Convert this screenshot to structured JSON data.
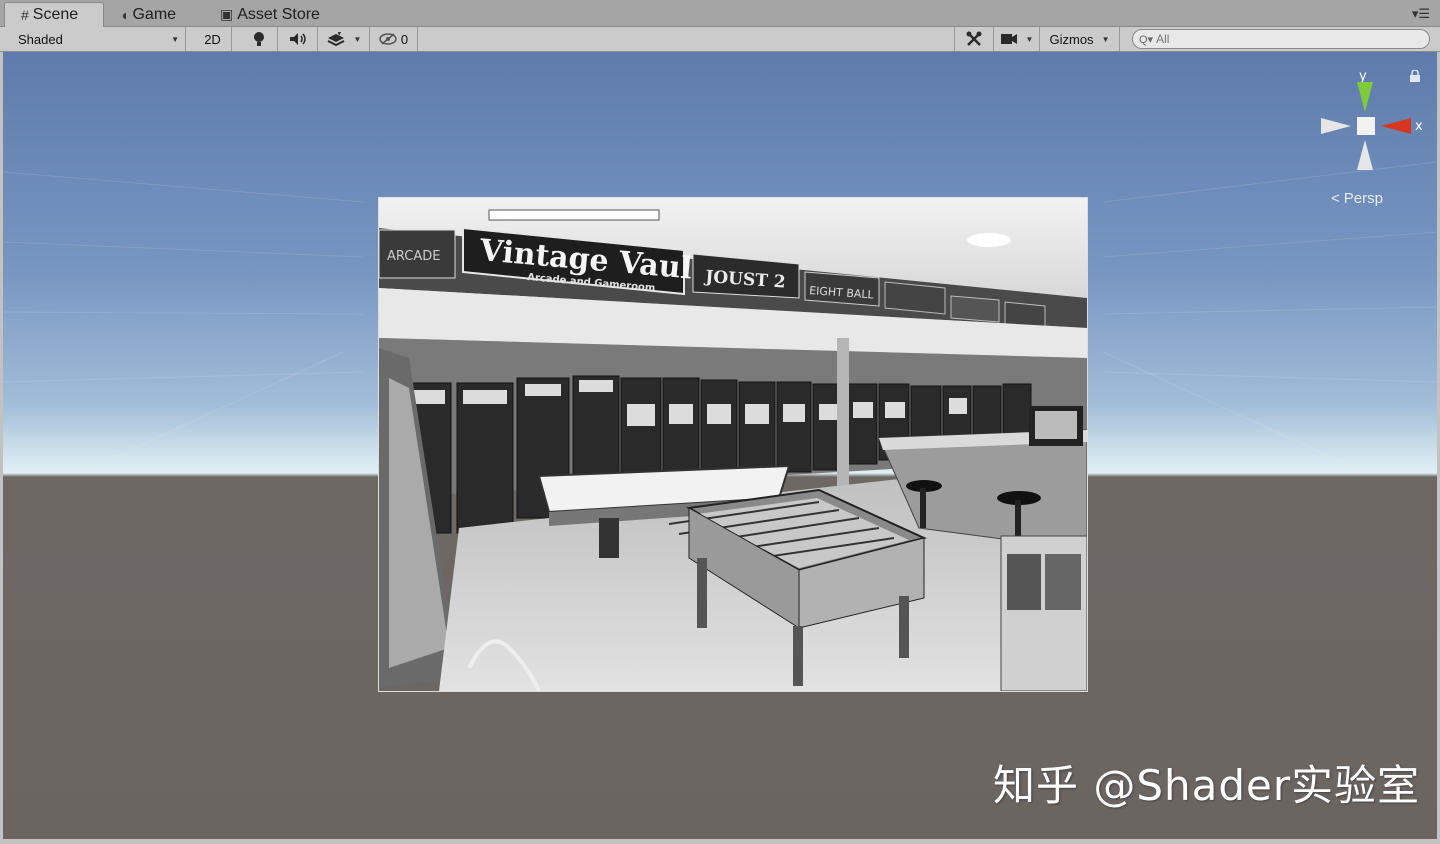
{
  "tabs": [
    {
      "label": "Scene",
      "icon": "scene-grid-icon",
      "active": true
    },
    {
      "label": "Game",
      "icon": "game-pacman-icon",
      "active": false
    },
    {
      "label": "Asset Store",
      "icon": "asset-store-bag-icon",
      "active": false
    }
  ],
  "toolbar": {
    "draw_mode": "Shaded",
    "mode_2d": "2D",
    "hidden_count": "0",
    "gizmos_label": "Gizmos",
    "search_placeholder": "All"
  },
  "scene": {
    "projection_label": "Persp",
    "axis_x": "x",
    "axis_y": "y",
    "sky_color": "#6a87b8",
    "ground_color": "#6b6562"
  },
  "texture_signs": {
    "main_sign": "Vintage Vault",
    "main_sign_sub": "Arcade and Gameroom",
    "left_sign": "ARCADE",
    "middle_sign": "JOUST 2",
    "right_sign": "EIGHT BALL"
  },
  "watermark": "知乎 @Shader实验室"
}
